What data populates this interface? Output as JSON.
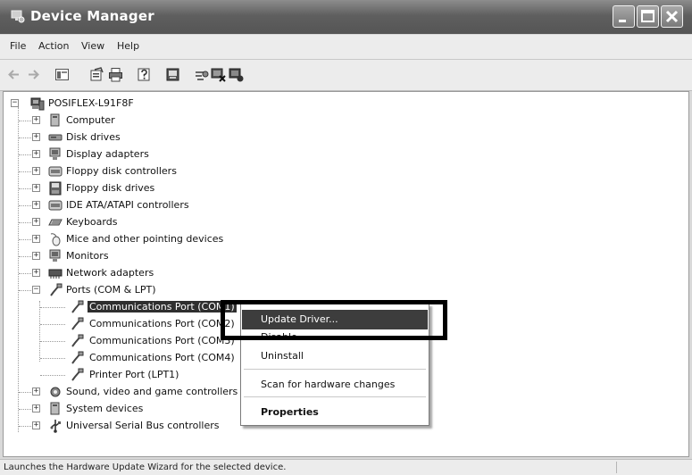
{
  "window": {
    "title": "Device Manager"
  },
  "menu": [
    "File",
    "Action",
    "View",
    "Help"
  ],
  "tree": {
    "root": "POSIFLEX-L91F8F",
    "categories": [
      "Computer",
      "Disk drives",
      "Display adapters",
      "Floppy disk controllers",
      "Floppy disk drives",
      "IDE ATA/ATAPI controllers",
      "Keyboards",
      "Mice and other pointing devices",
      "Monitors",
      "Network adapters",
      "Ports (COM & LPT)"
    ],
    "ports": [
      "Communications Port (COM1)",
      "Communications Port (COM2)",
      "Communications Port (COM3)",
      "Communications Port (COM4)",
      "Printer Port (LPT1)"
    ],
    "after": [
      "Sound, video and game controllers",
      "System devices",
      "Universal Serial Bus controllers"
    ]
  },
  "context_menu": {
    "update_driver": "Update Driver...",
    "disable": "Disable",
    "uninstall": "Uninstall",
    "scan": "Scan for hardware changes",
    "properties": "Properties"
  },
  "status": "Launches the Hardware Update Wizard for the selected device."
}
